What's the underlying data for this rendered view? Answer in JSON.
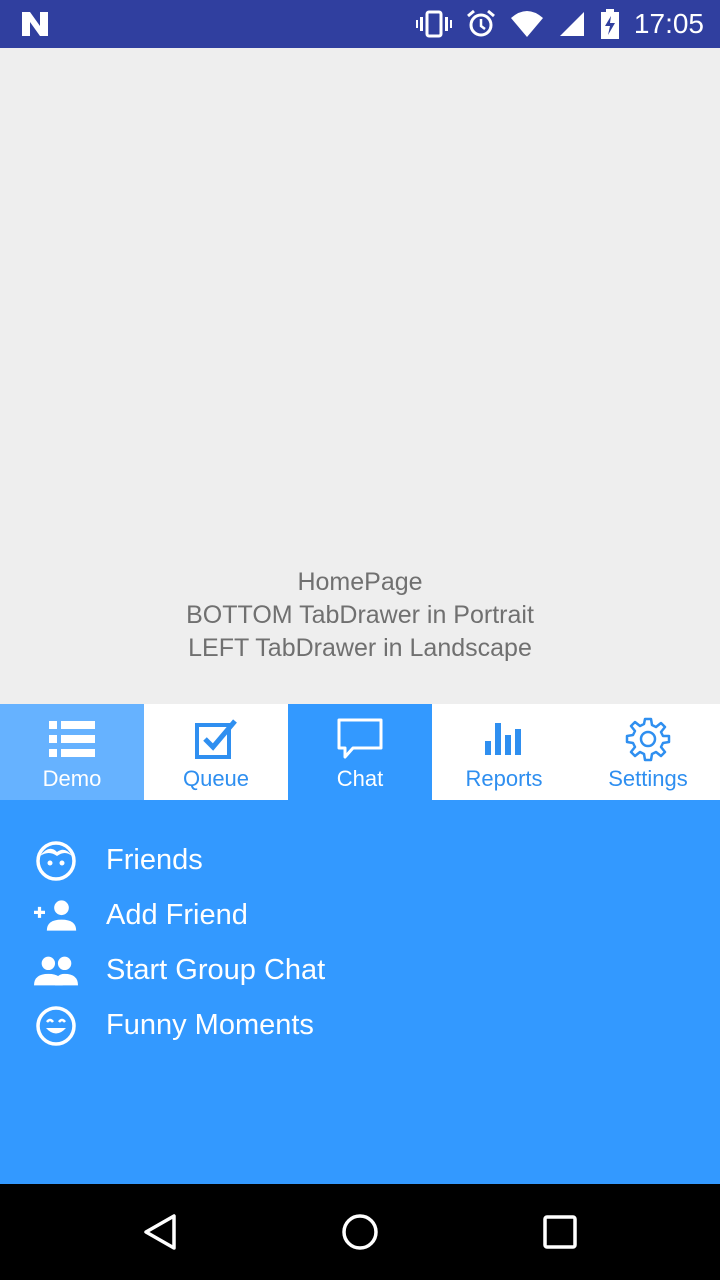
{
  "status_bar": {
    "time": "17:05",
    "icons": [
      "notification-n-icon",
      "vibrate-icon",
      "alarm-icon",
      "wifi-icon",
      "cell-signal-icon",
      "battery-charging-icon"
    ]
  },
  "home": {
    "line1": "HomePage",
    "line2": "BOTTOM TabDrawer in Portrait",
    "line3": "LEFT TabDrawer in Landscape"
  },
  "tabs": [
    {
      "label": "Demo",
      "icon": "list-icon"
    },
    {
      "label": "Queue",
      "icon": "checkbox-icon"
    },
    {
      "label": "Chat",
      "icon": "chat-bubble-icon"
    },
    {
      "label": "Reports",
      "icon": "bar-chart-icon"
    },
    {
      "label": "Settings",
      "icon": "gear-icon"
    }
  ],
  "drawer": {
    "items": [
      {
        "label": "Friends",
        "icon": "face-icon"
      },
      {
        "label": "Add Friend",
        "icon": "add-person-icon"
      },
      {
        "label": "Start Group Chat",
        "icon": "group-icon"
      },
      {
        "label": "Funny Moments",
        "icon": "smile-icon"
      }
    ]
  },
  "nav_bar": {
    "buttons": [
      "back-icon",
      "home-icon",
      "recents-icon"
    ]
  },
  "colors": {
    "status_bar": "#303f9f",
    "accent": "#3399ff",
    "demo_tab": "#66b2ff",
    "tab_text": "#2f8ff0",
    "background": "#eeeeee"
  }
}
